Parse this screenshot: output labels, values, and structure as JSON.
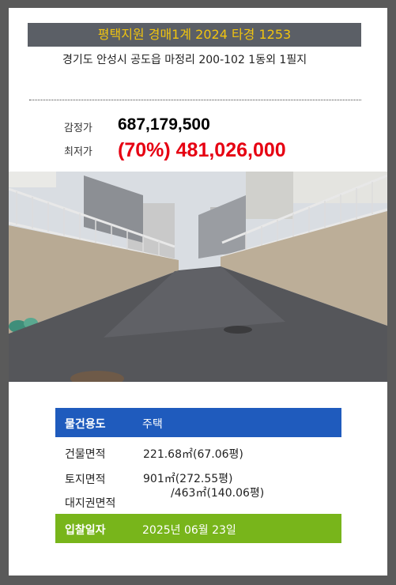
{
  "header": {
    "title": "평택지원 경매1계 2024 타경 1253"
  },
  "address": "경기도 안성시 공도읍 마정리 200-102 1동외 1필지",
  "price": {
    "appraisal_label": "감정가",
    "appraisal_value": "687,179,500",
    "minimum_label": "최저가",
    "minimum_value": "(70%) 481,026,000"
  },
  "photo": {
    "description": "paved-driveway-photo"
  },
  "details": {
    "use_label": "물건용도",
    "use_value": "주택",
    "building_label": "건물면적",
    "building_value": "221.68㎡(67.06평)",
    "land_label": "토지면적",
    "land_value_1": "901㎡(272.55평)",
    "land_value_2": "/463㎡(140.06평)",
    "land_right_label": "대지권면적",
    "date_label": "입찰일자",
    "date_value": "2025년 06월 23일"
  },
  "colors": {
    "title_bar": "#5b5f66",
    "title_text": "#f1c40f",
    "use_bar": "#1f5bbd",
    "date_bar": "#78b51b",
    "minimum_price": "#e60012"
  }
}
